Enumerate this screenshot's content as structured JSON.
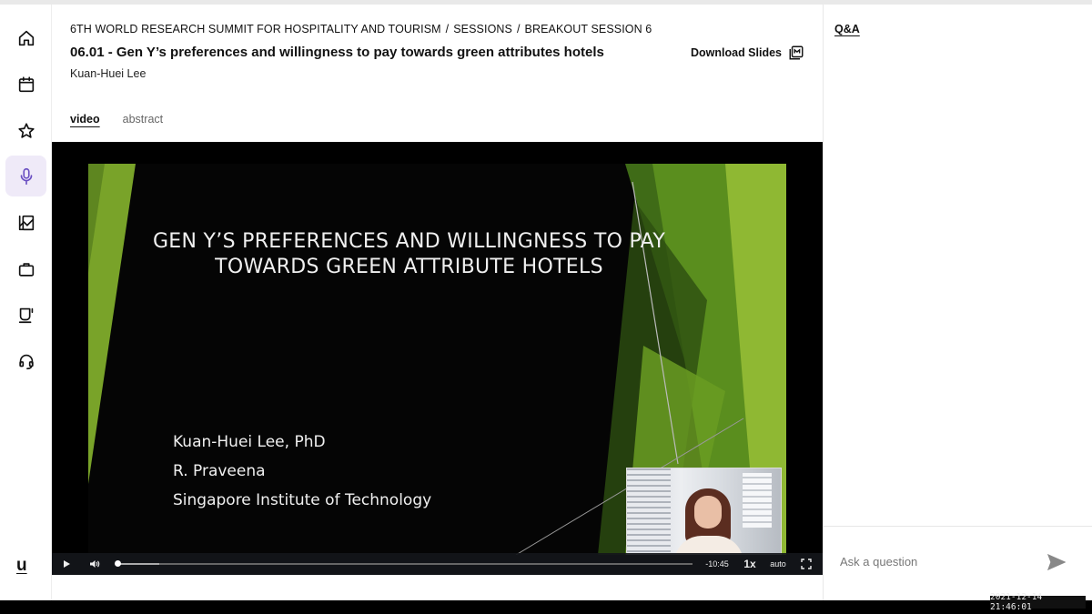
{
  "sidebar": {
    "items": [
      {
        "name": "home",
        "icon": "home-icon"
      },
      {
        "name": "schedule",
        "icon": "calendar-icon"
      },
      {
        "name": "favorites",
        "icon": "star-icon"
      },
      {
        "name": "sessions",
        "icon": "microphone-icon",
        "active": true
      },
      {
        "name": "posters",
        "icon": "image-icon"
      },
      {
        "name": "exhibitors",
        "icon": "briefcase-icon"
      },
      {
        "name": "lounge",
        "icon": "coffee-cup-icon"
      },
      {
        "name": "support",
        "icon": "headset-icon"
      }
    ],
    "brand": "u",
    "accent_color": "#6a4fc2"
  },
  "header": {
    "breadcrumb": [
      "6TH WORLD RESEARCH SUMMIT FOR HOSPITALITY AND TOURISM",
      "SESSIONS",
      "BREAKOUT SESSION 6"
    ],
    "breadcrumb_separator": "/",
    "title": "06.01 - Gen Y’s preferences and willingness to pay towards green attributes hotels",
    "author": "Kuan-Huei Lee",
    "download_label": "Download Slides"
  },
  "tabs": [
    {
      "label": "video",
      "active": true
    },
    {
      "label": "abstract",
      "active": false
    }
  ],
  "video": {
    "slide_title_line1": "GEN Y’S PREFERENCES AND WILLINGNESS TO PAY",
    "slide_title_line2": "TOWARDS GREEN ATTRIBUTE HOTELS",
    "slide_lines": [
      "Kuan-Huei Lee, PhD",
      "R. Praveena",
      "Singapore Institute of Technology"
    ],
    "time_remaining": "-10:45",
    "speed": "1x",
    "quality": "auto",
    "progress_fraction": 0.0,
    "buffered_fraction": 0.075
  },
  "qa": {
    "tab_label": "Q&A",
    "input_placeholder": "Ask a question"
  },
  "overlay": {
    "timestamp": "2021-12-14 21:46:01"
  }
}
